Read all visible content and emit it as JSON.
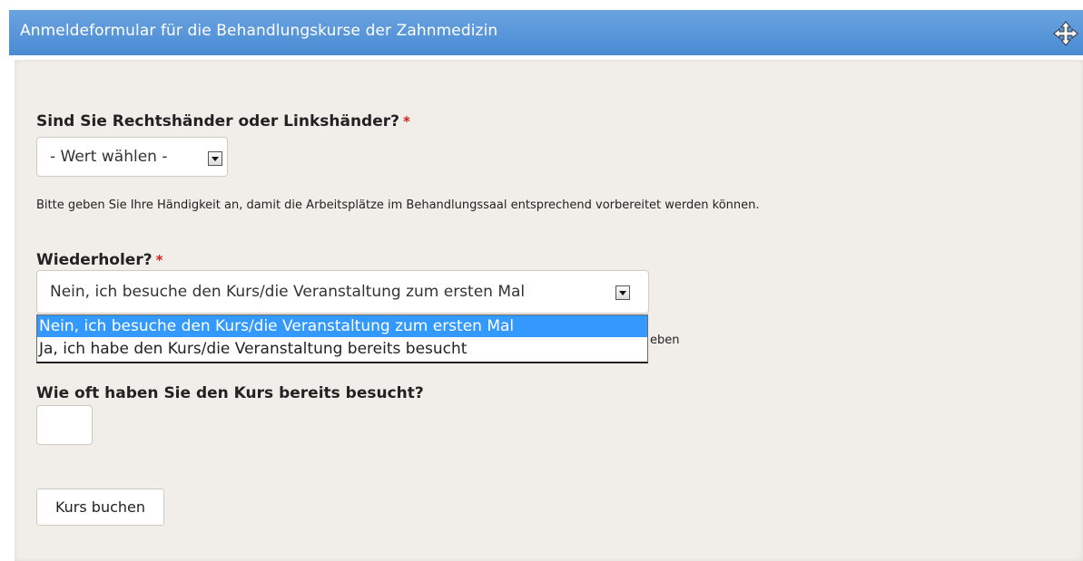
{
  "window": {
    "title": "Anmeldeformular für die Behandlungskurse der Zahnmedizin"
  },
  "form": {
    "handedness": {
      "label": "Sind Sie Rechtshänder oder Linkshänder?",
      "required_marker": "*",
      "selected": "- Wert wählen -",
      "help": "Bitte geben Sie Ihre Händigkeit an, damit die Arbeitsplätze im Behandlungssaal entsprechend vorbereitet werden können."
    },
    "repeater": {
      "label": "Wiederholer?",
      "required_marker": "*",
      "selected": "Nein, ich besuche den Kurs/die Veranstaltung zum ersten Mal",
      "options": [
        "Nein, ich besuche den Kurs/die Veranstaltung zum ersten Mal",
        "Ja, ich habe den Kurs/die Veranstaltung bereits besucht"
      ],
      "help_visible_fragment": "eben"
    },
    "times_attended": {
      "label": "Wie oft haben Sie den Kurs bereits besucht?",
      "value": ""
    },
    "submit_label": "Kurs buchen"
  },
  "colors": {
    "titlebar": "#4a8bd3",
    "panel": "#f1eee9",
    "selection": "#3399ff",
    "required": "#d22020"
  },
  "icons": {
    "move": "move-arrows-icon",
    "dropdown": "chevron-down-icon"
  }
}
